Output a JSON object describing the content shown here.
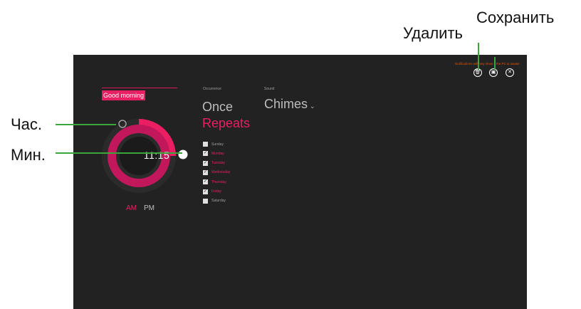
{
  "callouts": {
    "delete": "Удалить",
    "save": "Сохранить",
    "hour": "Час.",
    "minute": "Мин."
  },
  "alarm": {
    "name": "Good morning",
    "time": "11:15",
    "am": "AM",
    "pm": "PM",
    "selected_period": "AM"
  },
  "occurrence": {
    "label": "Occurrence",
    "once": "Once",
    "repeats": "Repeats",
    "selected": "Repeats"
  },
  "sound": {
    "label": "Sound",
    "value": "Chimes"
  },
  "days": [
    {
      "label": "Sunday",
      "checked": false
    },
    {
      "label": "Monday",
      "checked": true
    },
    {
      "label": "Tuesday",
      "checked": true
    },
    {
      "label": "Wednesday",
      "checked": true
    },
    {
      "label": "Thursday",
      "checked": true
    },
    {
      "label": "Friday",
      "checked": true
    },
    {
      "label": "Saturday",
      "checked": false
    }
  ],
  "notice": "Notifications will only show if the PC is awake",
  "colors": {
    "accent": "#e91e63",
    "accent_dark": "#c2185b",
    "background": "#222222",
    "callout_line": "#3aa63a",
    "notice": "#e65100"
  },
  "icons": {
    "delete": "trash-icon",
    "save": "save-icon",
    "close": "close-icon"
  }
}
